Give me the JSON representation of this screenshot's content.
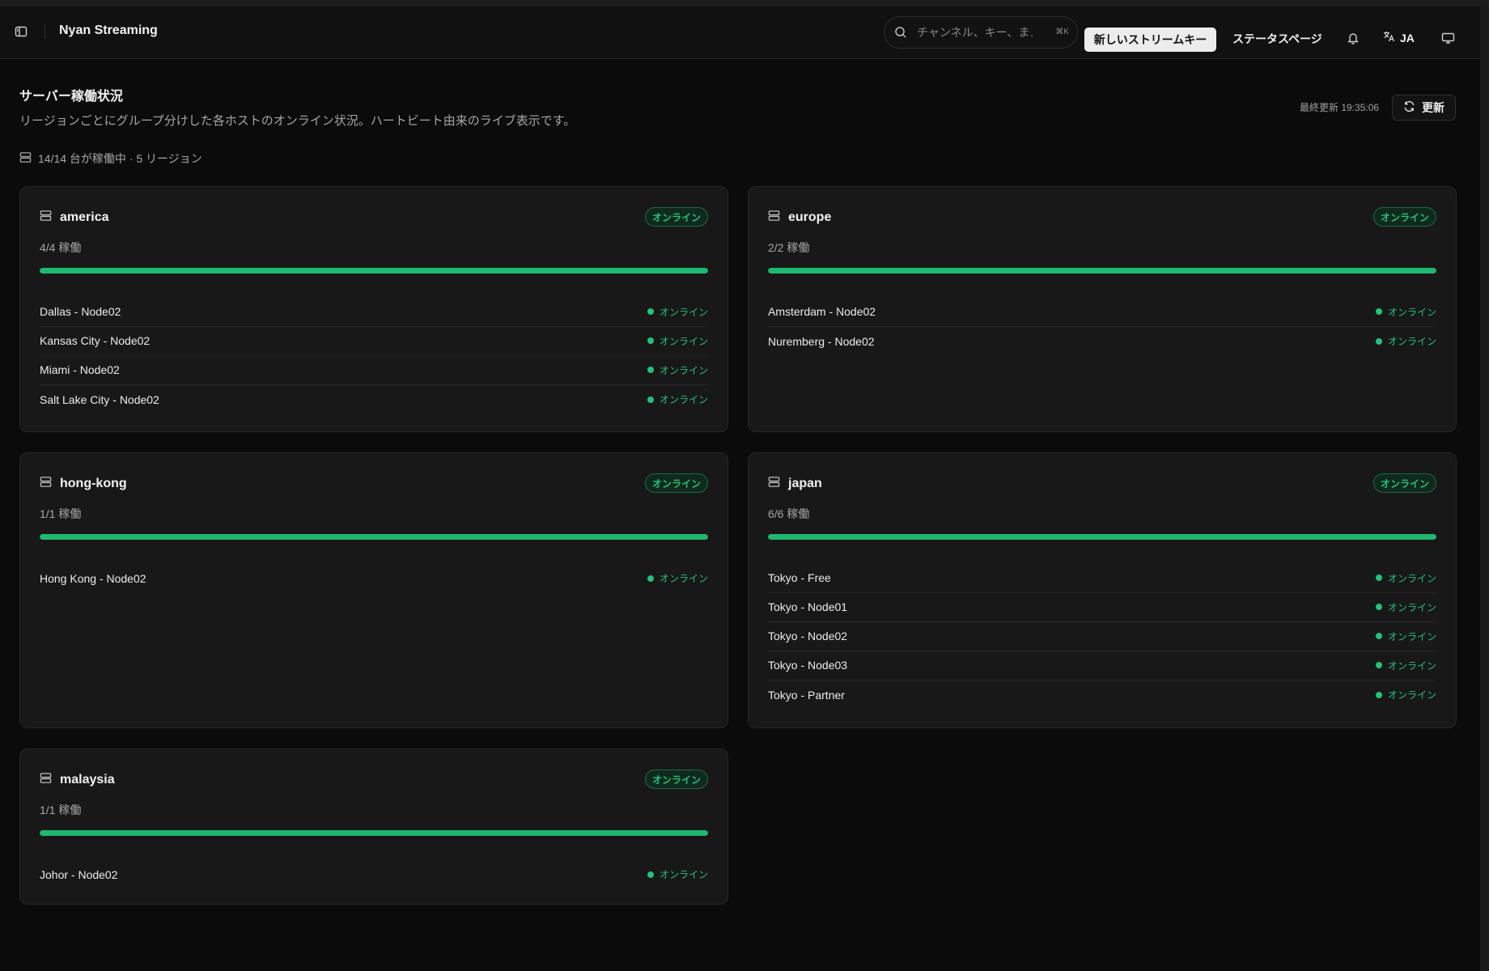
{
  "header": {
    "app_title": "Nyan Streaming",
    "search_placeholder": "チャンネル、キー、ま…",
    "search_shortcut": "⌘K",
    "new_key_label": "新しいストリームキー",
    "status_page_label": "ステータスページ",
    "language_label": "JA"
  },
  "page": {
    "title": "サーバー稼働状況",
    "subtitle": "リージョンごとにグループ分けした各ホストのオンライン状況。ハートビート由来のライブ表示です。",
    "last_updated": "最終更新 19:35:06",
    "refresh_label": "更新",
    "summary": "14/14 台が稼働中 · 5 リージョン"
  },
  "colors": {
    "online_green": "#22c27a",
    "background": "#0b0b0b",
    "card": "#181818"
  },
  "regions": [
    {
      "name": "america",
      "badge": "オンライン",
      "count": "4/4 稼働",
      "progress": 1.0,
      "hosts": [
        {
          "name": "Dallas - Node02",
          "status": "オンライン"
        },
        {
          "name": "Kansas City - Node02",
          "status": "オンライン"
        },
        {
          "name": "Miami - Node02",
          "status": "オンライン"
        },
        {
          "name": "Salt Lake City - Node02",
          "status": "オンライン"
        }
      ]
    },
    {
      "name": "europe",
      "badge": "オンライン",
      "count": "2/2 稼働",
      "progress": 1.0,
      "hosts": [
        {
          "name": "Amsterdam - Node02",
          "status": "オンライン"
        },
        {
          "name": "Nuremberg - Node02",
          "status": "オンライン"
        }
      ]
    },
    {
      "name": "hong-kong",
      "badge": "オンライン",
      "count": "1/1 稼働",
      "progress": 1.0,
      "hosts": [
        {
          "name": "Hong Kong - Node02",
          "status": "オンライン"
        }
      ]
    },
    {
      "name": "japan",
      "badge": "オンライン",
      "count": "6/6 稼働",
      "progress": 1.0,
      "hosts": [
        {
          "name": "Tokyo - Free",
          "status": "オンライン"
        },
        {
          "name": "Tokyo - Node01",
          "status": "オンライン"
        },
        {
          "name": "Tokyo - Node02",
          "status": "オンライン"
        },
        {
          "name": "Tokyo - Node03",
          "status": "オンライン"
        },
        {
          "name": "Tokyo - Partner",
          "status": "オンライン"
        }
      ]
    },
    {
      "name": "malaysia",
      "badge": "オンライン",
      "count": "1/1 稼働",
      "progress": 1.0,
      "hosts": [
        {
          "name": "Johor - Node02",
          "status": "オンライン"
        }
      ]
    }
  ]
}
